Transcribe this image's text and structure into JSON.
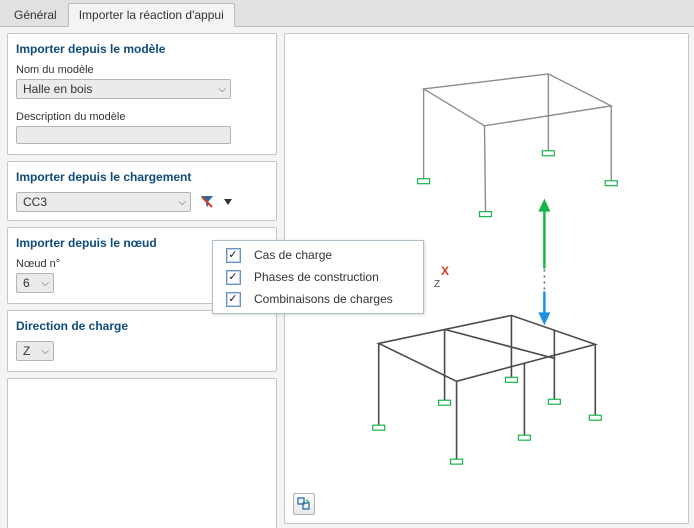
{
  "tabs": {
    "general": "Général",
    "import": "Importer la réaction d'appui"
  },
  "panels": {
    "model": {
      "title": "Importer depuis le modèle",
      "nameLabel": "Nom du modèle",
      "nameValue": "Halle en bois",
      "descLabel": "Description du modèle",
      "descValue": ""
    },
    "loading": {
      "title": "Importer depuis le chargement",
      "value": "CC3"
    },
    "node": {
      "title": "Importer depuis le nœud",
      "label": "Nœud n°",
      "value": "6"
    },
    "direction": {
      "title": "Direction de charge",
      "value": "Z"
    }
  },
  "popup": {
    "item1": "Cas de charge",
    "item2": "Phases de construction",
    "item3": "Combinaisons de charges"
  },
  "viewport": {
    "axisX": "X",
    "axisZ": "Z"
  }
}
